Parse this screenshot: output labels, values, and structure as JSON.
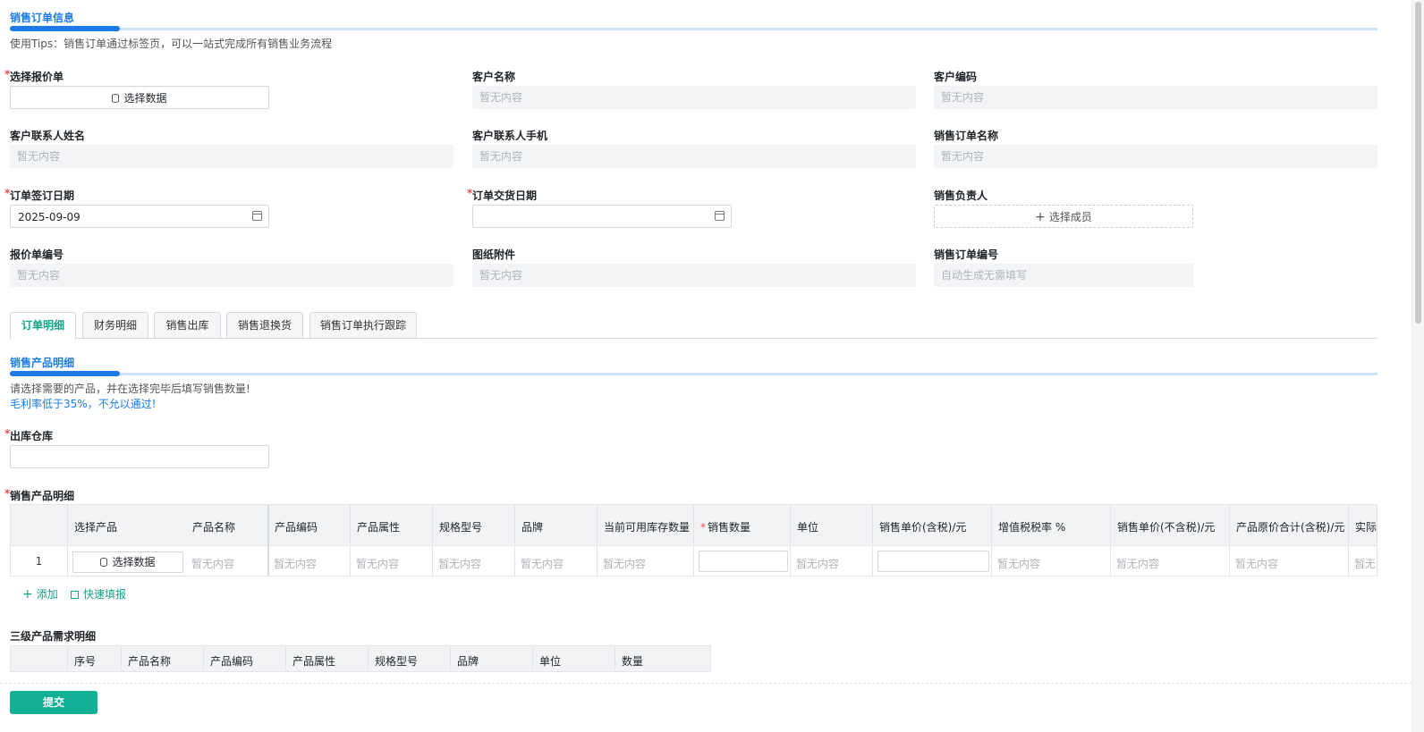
{
  "header": {
    "title": "销售订单信息",
    "tip": "使用Tips：销售订单通过标签页，可以一站式完成所有销售业务流程"
  },
  "form": {
    "quote_select": {
      "label": "选择报价单",
      "button": "选择数据",
      "required": "*"
    },
    "customer_name": {
      "label": "客户名称",
      "value": "暂无内容"
    },
    "customer_code": {
      "label": "客户编码",
      "value": "暂无内容"
    },
    "contact_name": {
      "label": "客户联系人姓名",
      "value": "暂无内容"
    },
    "contact_phone": {
      "label": "客户联系人手机",
      "value": "暂无内容"
    },
    "order_name": {
      "label": "销售订单名称",
      "value": "暂无内容"
    },
    "sign_date": {
      "label": "订单签订日期",
      "value": "2025-09-09",
      "required": "*"
    },
    "delivery_date": {
      "label": "订单交货日期",
      "value": "",
      "required": "*"
    },
    "sales_owner": {
      "label": "销售负责人",
      "button": "选择成员"
    },
    "quote_no": {
      "label": "报价单编号",
      "value": "暂无内容"
    },
    "drawing": {
      "label": "图纸附件",
      "value": "暂无内容"
    },
    "order_no": {
      "label": "销售订单编号",
      "value": "自动生成无需填写"
    }
  },
  "tabs": [
    "订单明细",
    "财务明细",
    "销售出库",
    "销售退换货",
    "销售订单执行跟踪"
  ],
  "product_section": {
    "title": "销售产品明细",
    "tip1": "请选择需要的产品，并在选择完毕后填写销售数量!",
    "tip2": "毛利率低于35%，不允以通过!",
    "warehouse_label": "出库仓库",
    "detail_label": "销售产品明细",
    "required": "*"
  },
  "product_table": {
    "columns": [
      "选择产品",
      "产品名称",
      "产品编码",
      "产品属性",
      "规格型号",
      "品牌",
      "当前可用库存数量",
      "销售数量",
      "单位",
      "销售单价(含税)/元",
      "增值税税率 %",
      "销售单价(不含税)/元",
      "产品原价合计(含税)/元",
      "实际销"
    ],
    "required_mark": "*",
    "row": {
      "index": "1",
      "select_button": "选择数据",
      "empty": "暂无内容"
    },
    "actions": {
      "add": "添加",
      "quick_fill": "快速填报"
    }
  },
  "level3_section": {
    "title": "三级产品需求明细",
    "columns": [
      "序号",
      "产品名称",
      "产品编码",
      "产品属性",
      "规格型号",
      "品牌",
      "单位",
      "数量"
    ]
  },
  "footer": {
    "submit": "提交"
  }
}
